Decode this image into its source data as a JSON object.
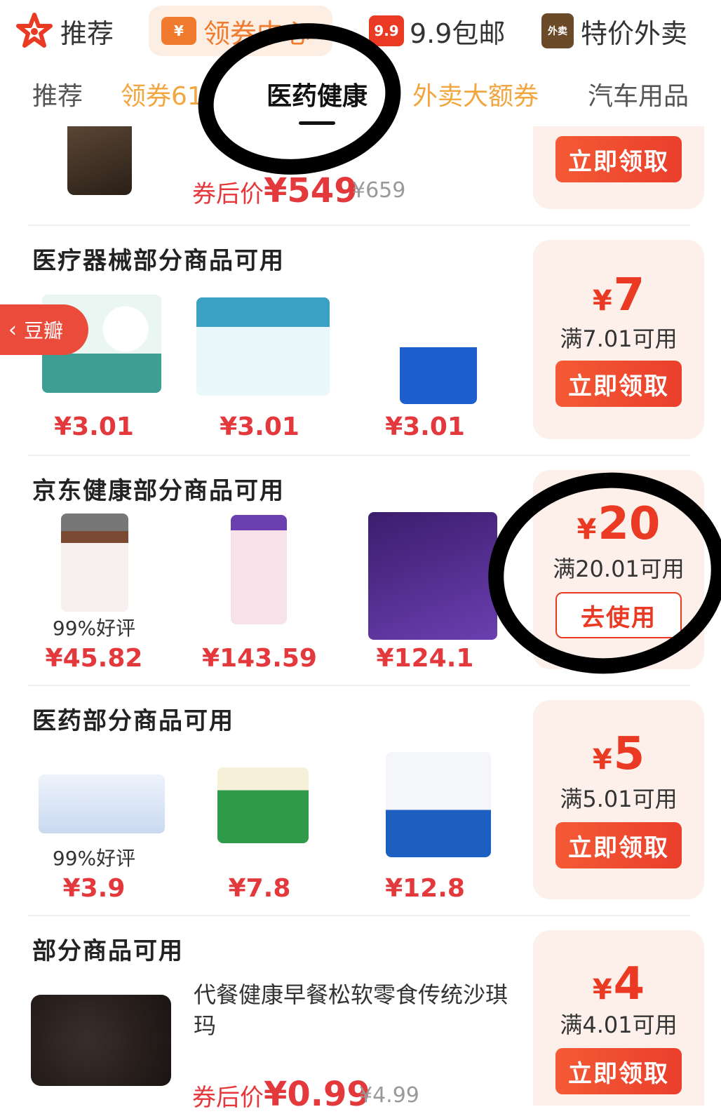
{
  "topnav": {
    "items": [
      {
        "label": "推荐",
        "icon": "star-icon"
      },
      {
        "label": "领券中心",
        "icon": "coupon-icon"
      },
      {
        "label": "9.9包邮",
        "icon": "9.9-badge-icon",
        "badge": "9.9"
      },
      {
        "label": "特价外卖",
        "icon": "takeout-bag-icon",
        "badge": "外卖"
      }
    ],
    "accent": "#f07a2d"
  },
  "subnav": {
    "items": [
      "推荐",
      "领券61",
      "医药健康",
      "外卖大额券",
      "汽车用品"
    ],
    "active": "医药健康"
  },
  "first": {
    "after_label": "券后价",
    "currency": "¥",
    "after_price": "549",
    "orig_price": "¥659",
    "button": "立即领取"
  },
  "sections": [
    {
      "title": "医疗器械部分商品可用",
      "products": [
        {
          "price": "¥3.01",
          "img": "cotton-wipes-image"
        },
        {
          "price": "¥3.01",
          "img": "alcohol-pads-box-image"
        },
        {
          "price": "¥3.01",
          "img": "collagen-mask-image"
        }
      ],
      "coupon": {
        "amount": "7",
        "condition": "满7.01可用",
        "button": "立即领取"
      }
    },
    {
      "title": "京东健康部分商品可用",
      "products": [
        {
          "price": "¥45.82",
          "rating": "99%好评",
          "img": "ventrifit-bottle-image"
        },
        {
          "price": "¥143.59",
          "img": "hair-skin-nails-bottle-image"
        },
        {
          "price": "¥124.1",
          "img": "slimming-product-image"
        }
      ],
      "coupon": {
        "amount": "20",
        "condition": "满20.01可用",
        "button": "去使用"
      }
    },
    {
      "title": "医药部分商品可用",
      "products": [
        {
          "price": "¥3.9",
          "rating": "99%好评",
          "img": "ambroxol-tablets-image"
        },
        {
          "price": "¥7.8",
          "img": "cold-granules-box-image"
        },
        {
          "price": "¥12.8",
          "img": "dingke-granules-image"
        }
      ],
      "coupon": {
        "amount": "5",
        "condition": "满5.01可用",
        "button": "立即领取"
      }
    },
    {
      "title": "部分商品可用",
      "product_name": "代餐健康早餐松软零食传统沙琪玛",
      "after_label": "券后价",
      "after_price": "0.99",
      "orig_price": "¥4.99",
      "coupon": {
        "amount": "4",
        "condition": "满4.01可用",
        "button": "立即领取"
      }
    }
  ],
  "currency_symbol": "¥",
  "floating": {
    "douban": "豆瓣",
    "back_icon": "chevron-left-icon"
  },
  "colors": {
    "price_red": "#e4393c",
    "coupon_bg": "#fdf0ea",
    "button_red": "#ea3f2c",
    "highlight_marker": "#000000"
  }
}
